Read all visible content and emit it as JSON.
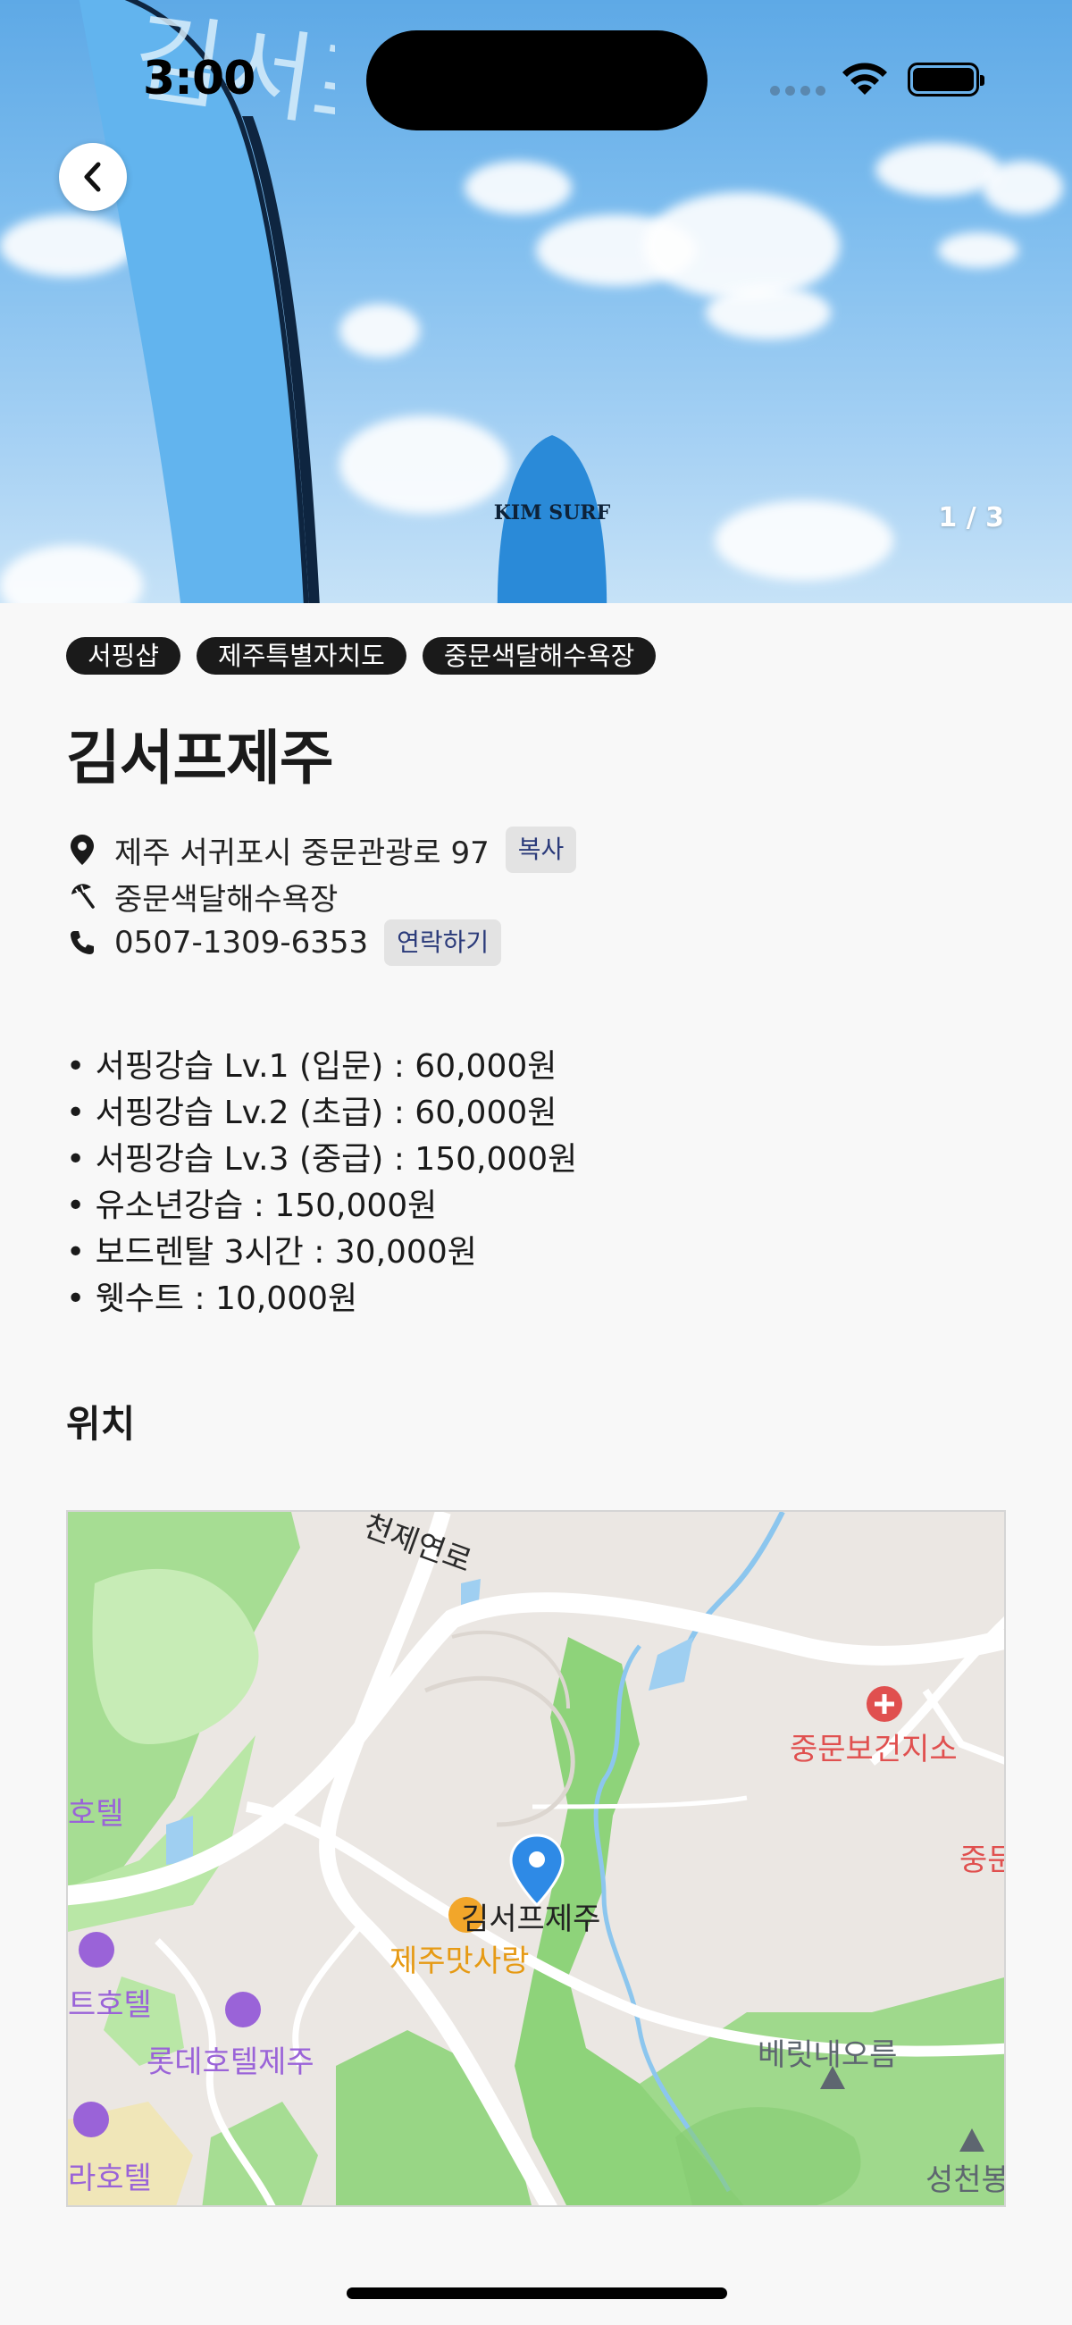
{
  "status_bar": {
    "time": "3:00"
  },
  "hero": {
    "counter": "1 / 3",
    "board_text": "KIM SURF",
    "flag_text": "김서프"
  },
  "tags": [
    "서핑샵",
    "제주특별자치도",
    "중문색달해수욕장"
  ],
  "title": "김서프제주",
  "info": {
    "address": "제주 서귀포시 중문관광로 97",
    "copy_label": "복사",
    "beach": "중문색달해수욕장",
    "phone": "0507-1309-6353",
    "contact_label": "연락하기"
  },
  "menu": [
    "• 서핑강습 Lv.1 (입문) : 60,000원",
    "• 서핑강습 Lv.2 (초급) : 60,000원",
    "• 서핑강습 Lv.3 (중급) : 150,000원",
    "• 유소년강습 : 150,000원",
    "• 보드렌탈 3시간 : 30,000원",
    "• 웻수트 : 10,000원"
  ],
  "location_title": "위치",
  "map": {
    "labels": {
      "road": "천제연로",
      "clinic": "중문보건지소",
      "clinic_cut": "중문",
      "hotel_left": "호텔",
      "pin": "김서프제주",
      "restaurant": "제주맛사랑",
      "hotel2": "트호텔",
      "lotte": "롯데호텔제주",
      "hotel3": "라호텔",
      "oreum": "베릿내오름",
      "seongcheon": "성천봉"
    },
    "colors": {
      "park": "#9fd98c",
      "water": "#9fcff1",
      "road": "#ffffff",
      "pin": "#2e8ae6",
      "hotel_label": "#9a63d8",
      "clinic_label": "#e0504f",
      "food_label": "#e69a14"
    }
  }
}
